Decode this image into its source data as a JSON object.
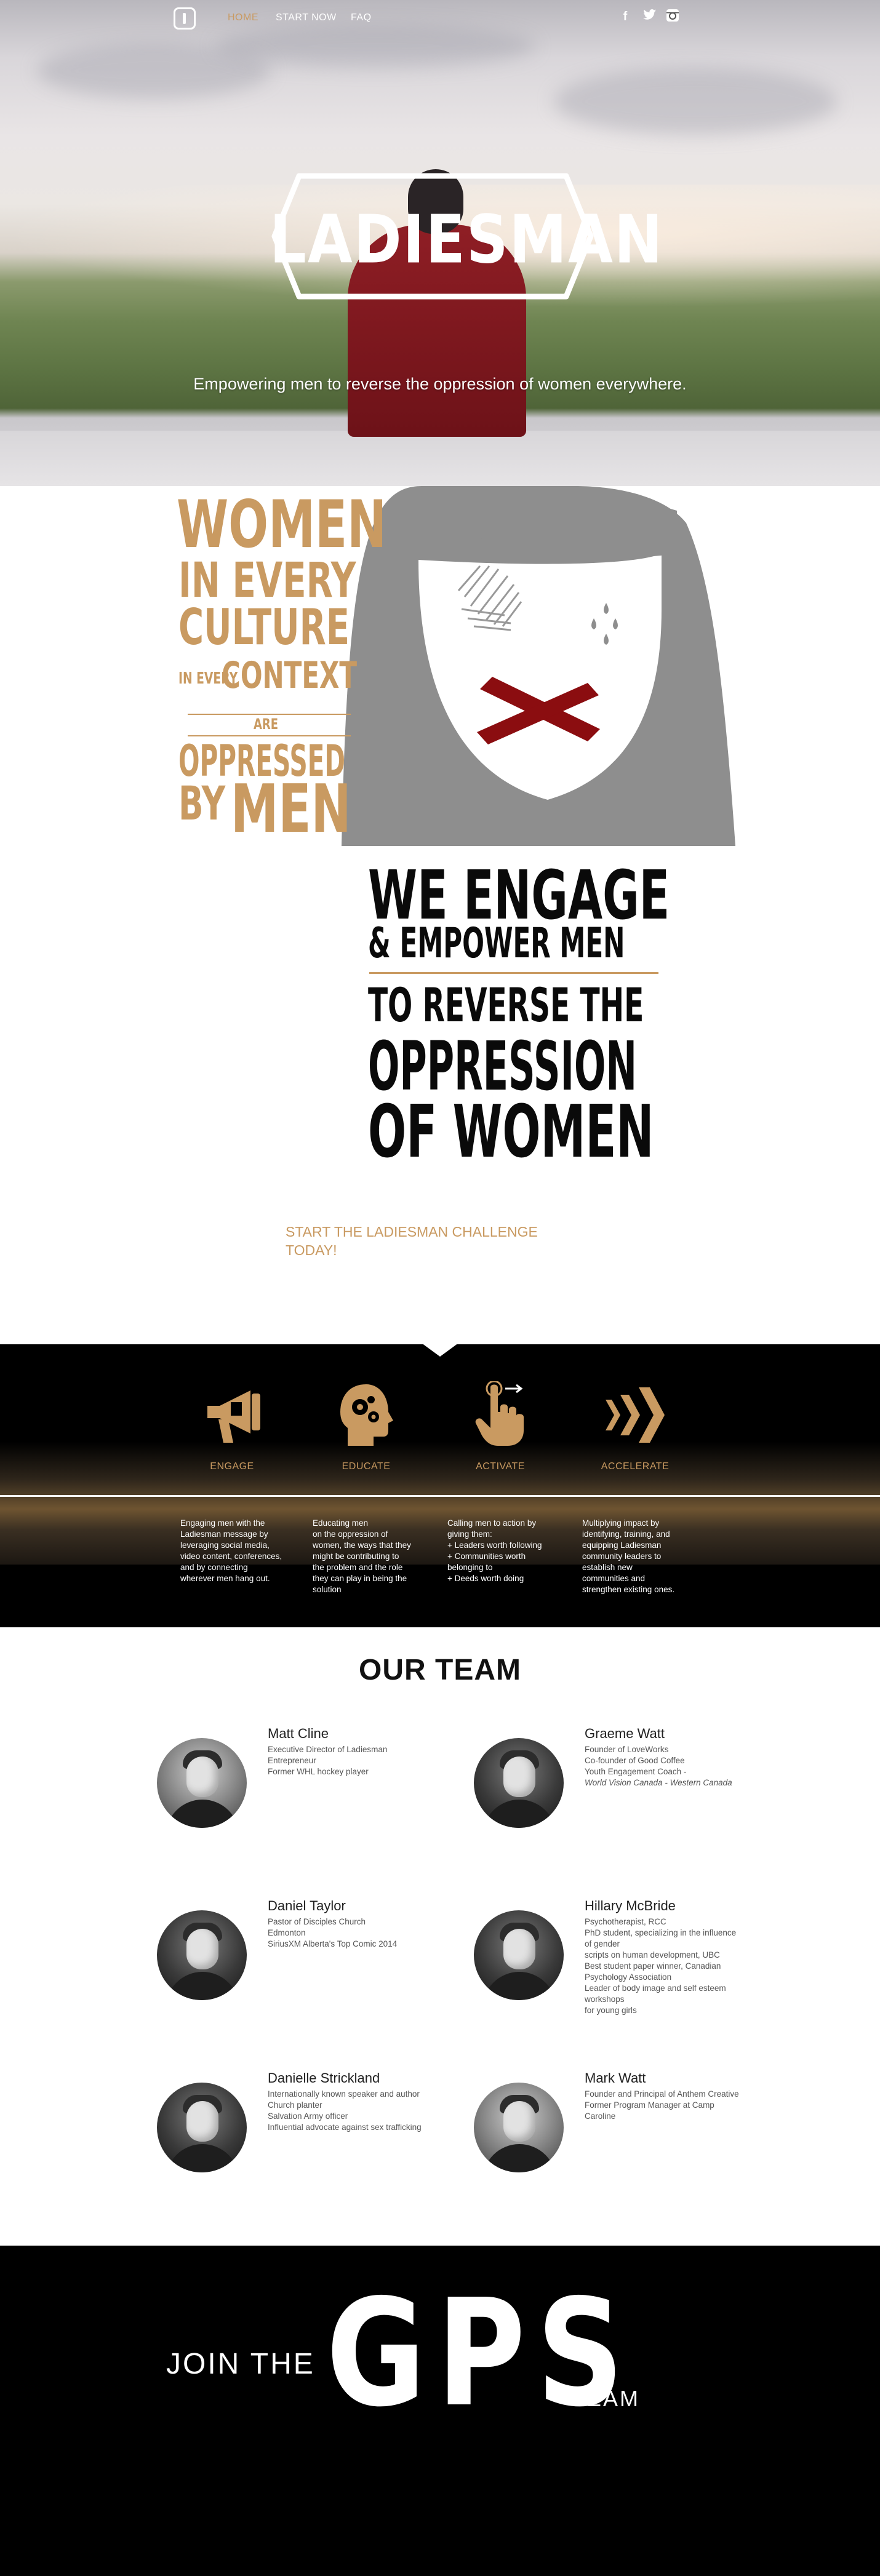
{
  "nav": {
    "links": [
      "HOME",
      "START NOW",
      "FAQ"
    ],
    "social_icons": [
      "facebook-icon",
      "twitter-icon",
      "instagram-icon"
    ]
  },
  "hero": {
    "brand": "LADIESMAN",
    "tagline": "Empowering men to reverse the oppression of women everywhere."
  },
  "poster": {
    "headline_lines": [
      "WOMEN",
      "IN EVERY",
      "CULTURE",
      "IN EVERY",
      "CONTEXT",
      "ARE",
      "OPPRESSED",
      "BY",
      "MEN"
    ],
    "engage_lines": [
      "WE ENGAGE",
      "& EMPOWER MEN",
      "TO REVERSE THE",
      "OPPRESSION",
      "OF WOMEN"
    ]
  },
  "challenge": {
    "link": "START THE LADIESMAN CHALLENGE TODAY!"
  },
  "steps": [
    {
      "icon": "megaphone-icon",
      "label": "ENGAGE",
      "desc": "Engaging men with the\nLadiesman message by\nleveraging social media,\nvideo content, conferences,\nand by connecting\nwherever men hang out."
    },
    {
      "icon": "brain-gears-icon",
      "label": "EDUCATE",
      "desc": "Educating men\non the oppression of\nwomen, the ways that they\nmight be contributing to\nthe problem and the role\nthey can play in being the\nsolution"
    },
    {
      "icon": "hand-pointer-icon",
      "label": "ACTIVATE",
      "desc": "Calling men to action by\ngiving them:\n+ Leaders worth following\n+ Communities worth\nbelonging to\n+ Deeds worth doing"
    },
    {
      "icon": "chevrons-right-icon",
      "label": "ACCELERATE",
      "desc": "Multiplying impact by\nidentifying, training, and\nequipping Ladiesman\ncommunity leaders to\nestablish new\ncommunities and\nstrengthen existing ones."
    }
  ],
  "team": {
    "heading": "OUR TEAM",
    "members": [
      {
        "name": "Matt Cline",
        "lines": [
          "Executive Director of Ladiesman",
          "Entrepreneur",
          "Former WHL hockey player"
        ],
        "italic_lines": []
      },
      {
        "name": "Graeme Watt",
        "lines": [
          "Founder of LoveWorks",
          "Co-founder of Good Coffee",
          "Youth Engagement Coach -"
        ],
        "italic_lines": [
          "World Vision Canada - Western Canada"
        ]
      },
      {
        "name": "Daniel Taylor",
        "lines": [
          "Pastor of Disciples Church",
          "Edmonton",
          "SiriusXM Alberta's Top Comic 2014"
        ],
        "italic_lines": []
      },
      {
        "name": "Hillary McBride",
        "lines": [
          "Psychotherapist, RCC",
          "PhD student, specializing in the influence of gender",
          "scripts on human development, UBC",
          "Best student paper winner, Canadian Psychology Association",
          "Leader of  body image and self esteem workshops",
          "for young girls"
        ],
        "italic_lines": []
      },
      {
        "name": "Danielle Strickland",
        "lines": [
          "Internationally known speaker and author",
          "Church planter",
          "Salvation Army officer",
          "Influential advocate against sex trafficking"
        ],
        "italic_lines": []
      },
      {
        "name": "Mark Watt",
        "lines": [
          "Founder and Principal of Anthem Creative",
          "Former Program Manager at Camp Caroline"
        ],
        "italic_lines": []
      }
    ]
  },
  "footer": {
    "join": "JOIN THE",
    "gps": "GPS",
    "team": "TEAM"
  },
  "colors": {
    "accent": "#c99a61",
    "dark": "#000000",
    "tape": "#8b0d10",
    "girl_gray": "#8e8e8e"
  }
}
